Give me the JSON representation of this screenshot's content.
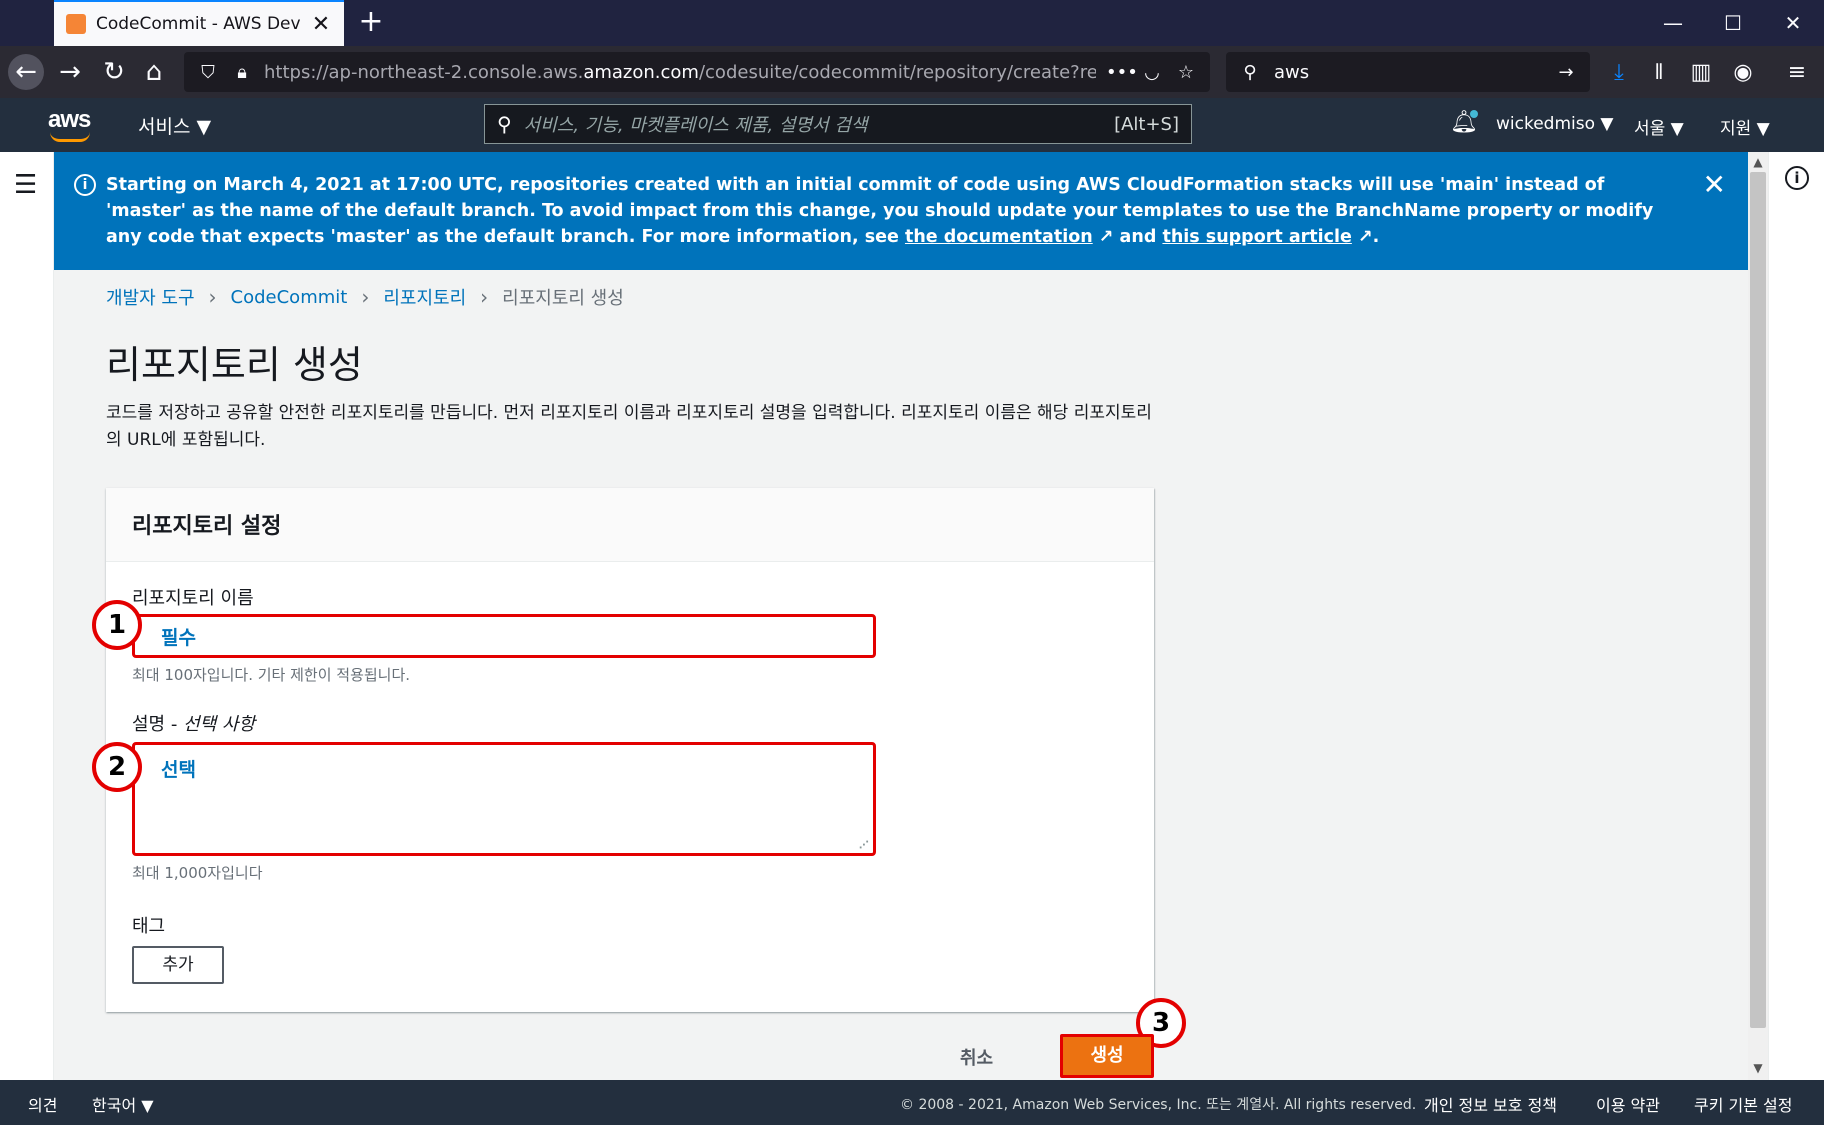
{
  "browser": {
    "tab_title": "CodeCommit - AWS Develope",
    "url_prefix": "https://ap-northeast-2.console.aws.",
    "url_domain": "amazon.com",
    "url_suffix": "/codesuite/codecommit/repository/create?region=ap-",
    "search_value": "aws"
  },
  "aws_header": {
    "logo": "aws",
    "services_label": "서비스 ▼",
    "search_placeholder": "서비스, 기능, 마켓플레이스 제품, 설명서 검색",
    "search_shortcut": "[Alt+S]",
    "user": "wickedmiso ▼",
    "region": "서울 ▼",
    "support": "지원 ▼"
  },
  "flashbar": {
    "text_1": "Starting on March 4, 2021 at 17:00 UTC, repositories created with an initial commit of code using AWS CloudFormation stacks will use 'main' instead of 'master' as the name of the default branch. To avoid impact from this change, you should update your templates to use the BranchName property or modify any code that expects 'master' as the default branch. For more information, see ",
    "link_1": "the documentation",
    "text_2": " and ",
    "link_2": "this support article",
    "text_3": "."
  },
  "breadcrumb": {
    "items": [
      "개발자 도구",
      "CodeCommit",
      "리포지토리"
    ],
    "current": "리포지토리 생성"
  },
  "page": {
    "title": "리포지토리 생성",
    "description": "코드를 저장하고 공유할 안전한 리포지토리를 만듭니다. 먼저 리포지토리 이름과 리포지토리 설명을 입력합니다. 리포지토리 이름은 해당 리포지토리의 URL에 포함됩니다."
  },
  "panel": {
    "title": "리포지토리 설정",
    "name_label": "리포지토리 이름",
    "name_placeholder": "필수",
    "name_hint": "최대 100자입니다. 기타 제한이 적용됩니다.",
    "desc_label": "설명 - ",
    "desc_label_optional": "선택 사항",
    "desc_placeholder": "선택",
    "desc_hint": "최대 1,000자입니다",
    "tags_label": "태그",
    "add_tag": "추가"
  },
  "actions": {
    "cancel": "취소",
    "create": "생성"
  },
  "steps": [
    "1",
    "2",
    "3"
  ],
  "footer": {
    "feedback": "의견",
    "language": "한국어 ▼",
    "copyright": "© 2008 - 2021, Amazon Web Services, Inc. 또는 계열사. All rights reserved.",
    "privacy": "개인 정보 보호 정책",
    "terms": "이용 약관",
    "cookies": "쿠키 기본 설정"
  },
  "colors": {
    "aws_header": "#232f3e",
    "flashbar": "#0073bb",
    "primary_button": "#ec7211",
    "annotation": "#e30000"
  }
}
